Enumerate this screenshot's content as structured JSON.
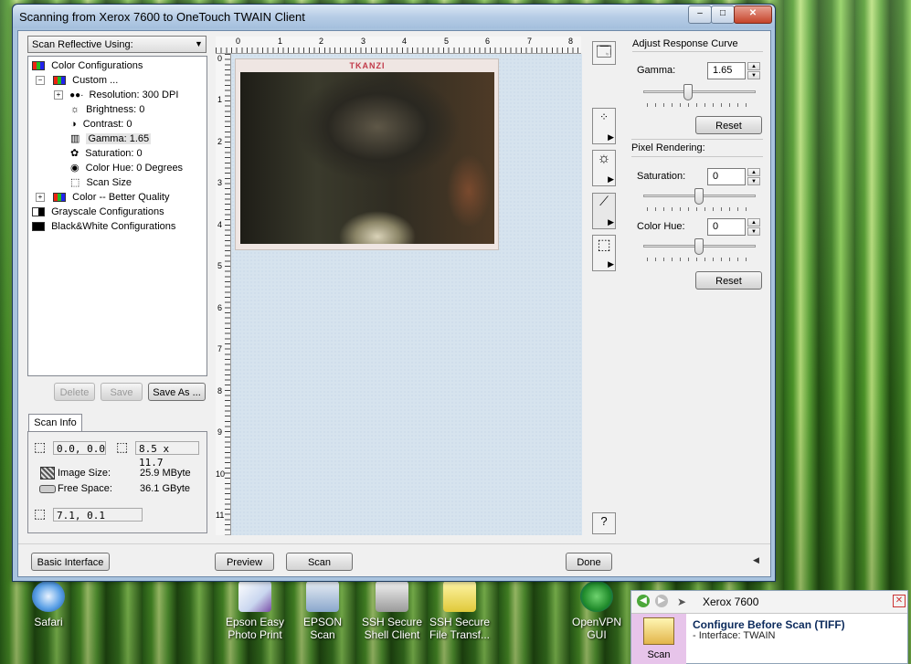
{
  "window": {
    "title": "Scanning from Xerox 7600 to OneTouch TWAIN Client",
    "controls": {
      "minimize": "‒",
      "maximize": "□",
      "close": "✕"
    }
  },
  "scan_mode": {
    "selected": "Scan Reflective Using:"
  },
  "tree": {
    "items": [
      {
        "label": "Color Configurations"
      },
      {
        "label": "Custom ..."
      },
      {
        "label": "Resolution: 300 DPI"
      },
      {
        "label": "Brightness: 0"
      },
      {
        "label": "Contrast: 0"
      },
      {
        "label": "Gamma: 1.65"
      },
      {
        "label": "Saturation: 0"
      },
      {
        "label": "Color Hue: 0 Degrees"
      },
      {
        "label": "Scan Size"
      },
      {
        "label": "Color -- Better Quality"
      },
      {
        "label": "Grayscale Configurations"
      },
      {
        "label": "Black&White Configurations"
      }
    ]
  },
  "config_buttons": {
    "delete": "Delete",
    "save": "Save",
    "save_as": "Save As ..."
  },
  "scan_info": {
    "tab": "Scan Info",
    "origin": "0.0, 0.0",
    "size": "8.5 x 11.7",
    "image_size_label": "Image Size:",
    "image_size_value": "25.9 MByte",
    "free_space_label": "Free Space:",
    "free_space_value": "36.1 GByte",
    "cursor": "7.1, 0.1"
  },
  "ruler": {
    "top": [
      "0",
      "1",
      "2",
      "3",
      "4",
      "5",
      "6",
      "7",
      "8"
    ],
    "left": [
      "0",
      "1",
      "2",
      "3",
      "4",
      "5",
      "6",
      "7",
      "8",
      "9",
      "10",
      "11"
    ]
  },
  "preview_image": {
    "caption": "TKANZI"
  },
  "right_panel": {
    "response_curve_title": "Adjust Response Curve",
    "gamma_label": "Gamma:",
    "gamma_value": "1.65",
    "reset1": "Reset",
    "pixel_rendering_title": "Pixel Rendering:",
    "saturation_label": "Saturation:",
    "saturation_value": "0",
    "hue_label": "Color Hue:",
    "hue_value": "0",
    "reset2": "Reset"
  },
  "bottom_buttons": {
    "basic_interface": "Basic Interface",
    "preview": "Preview",
    "scan": "Scan",
    "done": "Done"
  },
  "desktop_icons": [
    {
      "label1": "Safari",
      "label2": ""
    },
    {
      "label1": "Epson Easy",
      "label2": "Photo Print"
    },
    {
      "label1": "EPSON Scan",
      "label2": ""
    },
    {
      "label1": "SSH Secure",
      "label2": "Shell Client"
    },
    {
      "label1": "SSH Secure",
      "label2": "File Transf..."
    },
    {
      "label1": "OpenVPN",
      "label2": "GUI"
    }
  ],
  "notification": {
    "title": "Xerox 7600",
    "heading": "Configure Before Scan (TIFF)",
    "detail": "- Interface: TWAIN",
    "icon_label": "Scan"
  },
  "colors": {
    "accent": "#1d3b5e",
    "desktop": "#3c7d22",
    "preview_bg": "#d6e3ee"
  }
}
